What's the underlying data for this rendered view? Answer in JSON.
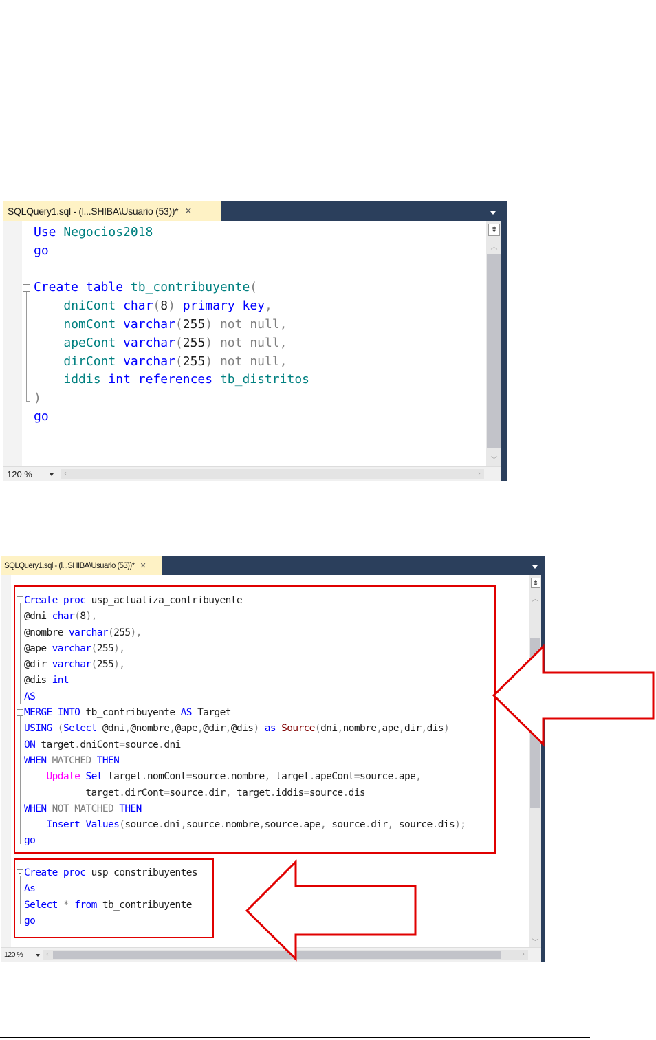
{
  "editor1": {
    "tab_title": "SQLQuery1.sql - (l...SHIBA\\Usuario (53))*",
    "close_glyph": "✕",
    "zoom_level": "120 %",
    "split_glyph": "⇟"
  },
  "editor2": {
    "tab_title": "SQLQuery1.sql - (l...SHIBA\\Usuario (53))*",
    "close_glyph": "✕",
    "zoom_level": "120 %",
    "split_glyph": "⇟"
  },
  "code1": [
    [
      [
        "kw",
        "Use"
      ],
      [
        "idn",
        " Negocios2018"
      ]
    ],
    [
      [
        "kw",
        "go"
      ]
    ],
    [
      [
        "n",
        ""
      ]
    ],
    [
      [
        "kw",
        "Create table"
      ],
      [
        "idn",
        " tb_contribuyente"
      ],
      [
        "gray",
        "("
      ]
    ],
    [
      [
        "n",
        "    "
      ],
      [
        "idn",
        "dniCont"
      ],
      [
        "n",
        " "
      ],
      [
        "kw",
        "char"
      ],
      [
        "gray",
        "("
      ],
      [
        "n",
        "8"
      ],
      [
        "gray",
        ")"
      ],
      [
        "n",
        " "
      ],
      [
        "kw",
        "primary key"
      ],
      [
        "gray",
        ","
      ]
    ],
    [
      [
        "n",
        "    "
      ],
      [
        "idn",
        "nomCont"
      ],
      [
        "n",
        " "
      ],
      [
        "kw",
        "varchar"
      ],
      [
        "gray",
        "("
      ],
      [
        "n",
        "255"
      ],
      [
        "gray",
        ")"
      ],
      [
        "n",
        " "
      ],
      [
        "gray",
        "not null,"
      ]
    ],
    [
      [
        "n",
        "    "
      ],
      [
        "idn",
        "apeCont"
      ],
      [
        "n",
        " "
      ],
      [
        "kw",
        "varchar"
      ],
      [
        "gray",
        "("
      ],
      [
        "n",
        "255"
      ],
      [
        "gray",
        ")"
      ],
      [
        "n",
        " "
      ],
      [
        "gray",
        "not null,"
      ]
    ],
    [
      [
        "n",
        "    "
      ],
      [
        "idn",
        "dirCont"
      ],
      [
        "n",
        " "
      ],
      [
        "kw",
        "varchar"
      ],
      [
        "gray",
        "("
      ],
      [
        "n",
        "255"
      ],
      [
        "gray",
        ")"
      ],
      [
        "n",
        " "
      ],
      [
        "gray",
        "not null,"
      ]
    ],
    [
      [
        "n",
        "    "
      ],
      [
        "idn",
        "iddis"
      ],
      [
        "n",
        " "
      ],
      [
        "kw",
        "int references"
      ],
      [
        "idn",
        " tb_distritos"
      ]
    ],
    [
      [
        "gray",
        ")"
      ]
    ],
    [
      [
        "kw",
        "go"
      ]
    ]
  ],
  "code2": [
    [
      [
        "kw",
        "Create proc"
      ],
      [
        "n",
        " usp_actualiza_contribuyente"
      ]
    ],
    [
      [
        "n",
        "@dni "
      ],
      [
        "kw",
        "char"
      ],
      [
        "gray",
        "("
      ],
      [
        "n",
        "8"
      ],
      [
        "gray",
        "),"
      ]
    ],
    [
      [
        "n",
        "@nombre "
      ],
      [
        "kw",
        "varchar"
      ],
      [
        "gray",
        "("
      ],
      [
        "n",
        "255"
      ],
      [
        "gray",
        "),"
      ]
    ],
    [
      [
        "n",
        "@ape "
      ],
      [
        "kw",
        "varchar"
      ],
      [
        "gray",
        "("
      ],
      [
        "n",
        "255"
      ],
      [
        "gray",
        "),"
      ]
    ],
    [
      [
        "n",
        "@dir "
      ],
      [
        "kw",
        "varchar"
      ],
      [
        "gray",
        "("
      ],
      [
        "n",
        "255"
      ],
      [
        "gray",
        "),"
      ]
    ],
    [
      [
        "n",
        "@dis "
      ],
      [
        "kw",
        "int"
      ]
    ],
    [
      [
        "kw",
        "AS"
      ]
    ],
    [
      [
        "kw",
        "MERGE"
      ],
      [
        "n",
        " "
      ],
      [
        "kw",
        "INTO"
      ],
      [
        "n",
        " tb_contribuyente "
      ],
      [
        "kw",
        "AS"
      ],
      [
        "n",
        " Target"
      ]
    ],
    [
      [
        "kw",
        "USING"
      ],
      [
        "n",
        " "
      ],
      [
        "gray",
        "("
      ],
      [
        "kw",
        "Select"
      ],
      [
        "n",
        " @dni"
      ],
      [
        "gray",
        ","
      ],
      [
        "n",
        "@nombre"
      ],
      [
        "gray",
        ","
      ],
      [
        "n",
        "@ape"
      ],
      [
        "gray",
        ","
      ],
      [
        "n",
        "@dir"
      ],
      [
        "gray",
        ","
      ],
      [
        "n",
        "@dis"
      ],
      [
        "gray",
        ")"
      ],
      [
        "n",
        " "
      ],
      [
        "kw",
        "as"
      ],
      [
        "n",
        " "
      ],
      [
        "fn",
        "Source"
      ],
      [
        "gray",
        "("
      ],
      [
        "n",
        "dni"
      ],
      [
        "gray",
        ","
      ],
      [
        "n",
        "nombre"
      ],
      [
        "gray",
        ","
      ],
      [
        "n",
        "ape"
      ],
      [
        "gray",
        ","
      ],
      [
        "n",
        "dir"
      ],
      [
        "gray",
        ","
      ],
      [
        "n",
        "dis"
      ],
      [
        "gray",
        ")"
      ]
    ],
    [
      [
        "kw",
        "ON"
      ],
      [
        "n",
        " target"
      ],
      [
        "gray",
        "."
      ],
      [
        "n",
        "dniCont"
      ],
      [
        "gray",
        "="
      ],
      [
        "n",
        "source"
      ],
      [
        "gray",
        "."
      ],
      [
        "n",
        "dni"
      ]
    ],
    [
      [
        "kw",
        "WHEN"
      ],
      [
        "n",
        " "
      ],
      [
        "gray",
        "MATCHED"
      ],
      [
        "n",
        " "
      ],
      [
        "kw",
        "THEN"
      ]
    ],
    [
      [
        "n",
        "    "
      ],
      [
        "pink",
        "Update"
      ],
      [
        "n",
        " "
      ],
      [
        "kw",
        "Set"
      ],
      [
        "n",
        " target"
      ],
      [
        "gray",
        "."
      ],
      [
        "n",
        "nomCont"
      ],
      [
        "gray",
        "="
      ],
      [
        "n",
        "source"
      ],
      [
        "gray",
        "."
      ],
      [
        "n",
        "nombre"
      ],
      [
        "gray",
        ","
      ],
      [
        "n",
        " target"
      ],
      [
        "gray",
        "."
      ],
      [
        "n",
        "apeCont"
      ],
      [
        "gray",
        "="
      ],
      [
        "n",
        "source"
      ],
      [
        "gray",
        "."
      ],
      [
        "n",
        "ape"
      ],
      [
        "gray",
        ","
      ]
    ],
    [
      [
        "n",
        "           target"
      ],
      [
        "gray",
        "."
      ],
      [
        "n",
        "dirCont"
      ],
      [
        "gray",
        "="
      ],
      [
        "n",
        "source"
      ],
      [
        "gray",
        "."
      ],
      [
        "n",
        "dir"
      ],
      [
        "gray",
        ","
      ],
      [
        "n",
        " target"
      ],
      [
        "gray",
        "."
      ],
      [
        "n",
        "iddis"
      ],
      [
        "gray",
        "="
      ],
      [
        "n",
        "source"
      ],
      [
        "gray",
        "."
      ],
      [
        "n",
        "dis"
      ]
    ],
    [
      [
        "kw",
        "WHEN"
      ],
      [
        "n",
        " "
      ],
      [
        "gray",
        "NOT"
      ],
      [
        "n",
        " "
      ],
      [
        "gray",
        "MATCHED"
      ],
      [
        "n",
        " "
      ],
      [
        "kw",
        "THEN"
      ]
    ],
    [
      [
        "n",
        "    "
      ],
      [
        "kw",
        "Insert"
      ],
      [
        "n",
        " "
      ],
      [
        "kw",
        "Values"
      ],
      [
        "gray",
        "("
      ],
      [
        "n",
        "source"
      ],
      [
        "gray",
        "."
      ],
      [
        "n",
        "dni"
      ],
      [
        "gray",
        ","
      ],
      [
        "n",
        "source"
      ],
      [
        "gray",
        "."
      ],
      [
        "n",
        "nombre"
      ],
      [
        "gray",
        ","
      ],
      [
        "n",
        "source"
      ],
      [
        "gray",
        "."
      ],
      [
        "n",
        "ape"
      ],
      [
        "gray",
        ","
      ],
      [
        "n",
        " source"
      ],
      [
        "gray",
        "."
      ],
      [
        "n",
        "dir"
      ],
      [
        "gray",
        ","
      ],
      [
        "n",
        " source"
      ],
      [
        "gray",
        "."
      ],
      [
        "n",
        "dis"
      ],
      [
        "gray",
        ");"
      ]
    ],
    [
      [
        "kw",
        "go"
      ]
    ],
    [
      [
        "n",
        ""
      ]
    ],
    [
      [
        "kw",
        "Create proc"
      ],
      [
        "n",
        " usp_constribuyentes"
      ]
    ],
    [
      [
        "kw",
        "As"
      ]
    ],
    [
      [
        "kw",
        "Select"
      ],
      [
        "n",
        " "
      ],
      [
        "gray",
        "*"
      ],
      [
        "n",
        " "
      ],
      [
        "kw",
        "from"
      ],
      [
        "n",
        " tb_contribuyente"
      ]
    ],
    [
      [
        "kw",
        "go"
      ]
    ]
  ],
  "colors": {
    "keyword": "#0000ff",
    "identifier": "#008080",
    "function": "#800000",
    "update_keyword": "#ff00ff",
    "operator": "#808080",
    "tab_active": "#fef2c5",
    "frame": "#2b3f5c",
    "highlight": "#e00000"
  }
}
